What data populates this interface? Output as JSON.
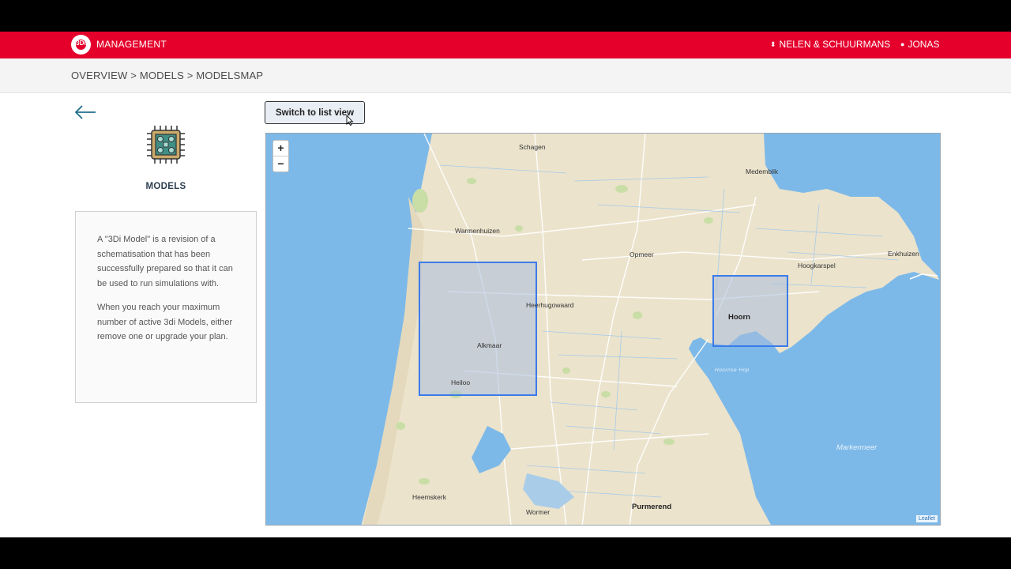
{
  "header": {
    "logo_text": "3Di",
    "app_title": "MANAGEMENT",
    "organisation": "NELEN & SCHUURMANS",
    "user": "JONAS"
  },
  "breadcrumb": "OVERVIEW > MODELS > MODELSMAP",
  "sidebar": {
    "title": "MODELS",
    "info_paragraphs": [
      "A \"3Di Model\" is a revision of a schematisation that has been successfully prepared so that it can be used to run simulations with.",
      "When you reach your maximum number of active 3di Models, either remove one or upgrade your plan."
    ]
  },
  "switch_button": "Switch to list view",
  "map": {
    "zoom_in": "+",
    "zoom_out": "−",
    "attribution": "Leaflet",
    "places": {
      "schagen": "Schagen",
      "medemblik": "Medemblik",
      "warmenhuizen": "Warmenhuizen",
      "opmeer": "Opmeer",
      "hoogkarspel": "Hoogkarspel",
      "enkhuizen": "Enkhuizen",
      "heerhugowaard": "Heerhugowaard",
      "hoorn": "Hoorn",
      "alkmaar": "Alkmaar",
      "heiloo": "Heiloo",
      "hoornse_hop": "Hoornse Hop",
      "markermeer": "Markermeer",
      "heemskerk": "Heemskerk",
      "purmerend": "Purmerend",
      "wormer": "Wormer"
    }
  },
  "colors": {
    "brand": "#e4002b",
    "sea": "#7db9e8",
    "land": "#ebe3cc",
    "model_border": "#3a7bea"
  }
}
